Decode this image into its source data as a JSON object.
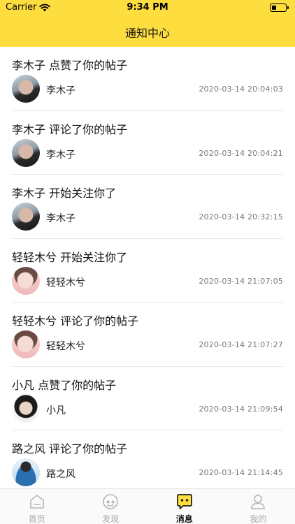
{
  "status": {
    "carrier": "Carrier",
    "time": "9:34 PM",
    "battery_level": 0.35
  },
  "nav": {
    "title": "通知中心"
  },
  "notifications": [
    {
      "title": "李木子 点赞了你的帖子",
      "user": "李木子",
      "time": "2020-03-14 20:04:03",
      "avatar": "avatar-photo-dark"
    },
    {
      "title": "李木子 评论了你的帖子",
      "user": "李木子",
      "time": "2020-03-14 20:04:21",
      "avatar": "avatar-photo-dark"
    },
    {
      "title": "李木子 开始关注你了",
      "user": "李木子",
      "time": "2020-03-14 20:32:15",
      "avatar": "avatar-photo-dark"
    },
    {
      "title": "轻轻木兮 开始关注你了",
      "user": "轻轻木兮",
      "time": "2020-03-14 21:07:05",
      "avatar": "avatar-photo-pink"
    },
    {
      "title": "轻轻木兮 评论了你的帖子",
      "user": "轻轻木兮",
      "time": "2020-03-14 21:07:27",
      "avatar": "avatar-photo-pink"
    },
    {
      "title": "小凡 点赞了你的帖子",
      "user": "小凡",
      "time": "2020-03-14 21:09:54",
      "avatar": "avatar-photo-bw"
    },
    {
      "title": "路之风 评论了你的帖子",
      "user": "路之风",
      "time": "2020-03-14 21:14:45",
      "avatar": "avatar-photo-blue"
    }
  ],
  "tabbar": {
    "home": {
      "label": "首页",
      "icon": "home-icon"
    },
    "discover": {
      "label": "发现",
      "icon": "discover-icon"
    },
    "messages": {
      "label": "消息",
      "icon": "message-icon",
      "active": true
    },
    "profile": {
      "label": "我的",
      "icon": "profile-icon"
    }
  },
  "colors": {
    "accent": "#fedd3f",
    "divider": "#e7e7e7",
    "inactive": "#a9a9a9"
  }
}
